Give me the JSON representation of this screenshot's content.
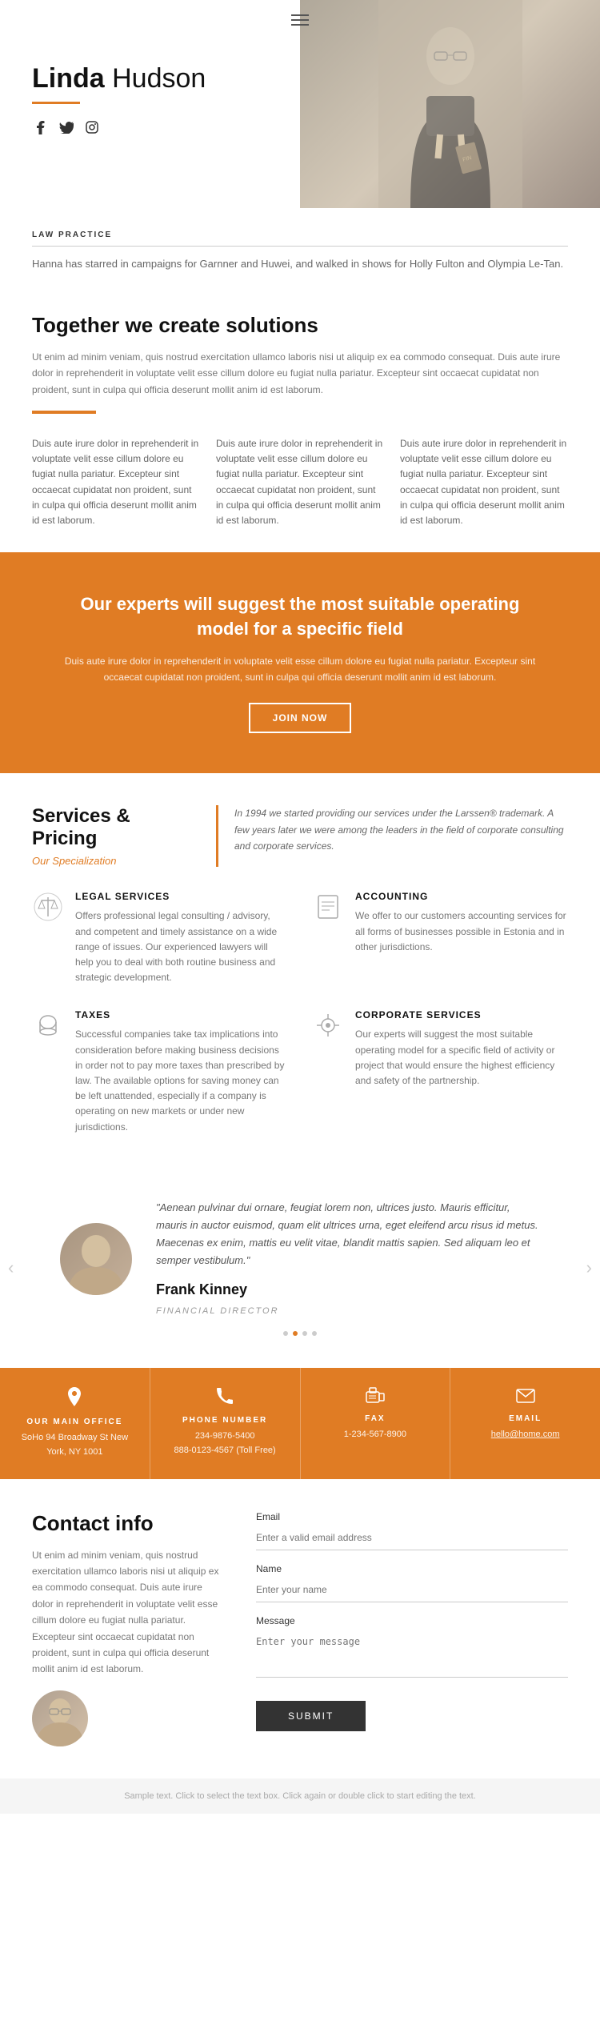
{
  "header": {
    "hamburger_label": "menu",
    "name_first": "Linda",
    "name_last": "Hudson",
    "social": [
      {
        "name": "facebook",
        "icon": "f"
      },
      {
        "name": "twitter",
        "icon": "t"
      },
      {
        "name": "instagram",
        "icon": "in"
      }
    ]
  },
  "law_section": {
    "label": "LAW PRACTICE",
    "text": "Hanna has starred in campaigns for Garnner and Huwei, and walked in shows for Holly Fulton and Olympia Le-Tan."
  },
  "solutions": {
    "title": "Together we create solutions",
    "desc": "Ut enim ad minim veniam, quis nostrud exercitation ullamco laboris nisi ut aliquip ex ea commodo consequat. Duis aute irure dolor in reprehenderit in voluptate velit esse cillum dolore eu fugiat nulla pariatur. Excepteur sint occaecat cupidatat non proident, sunt in culpa qui officia deserunt mollit anim id est laborum.",
    "col1": "Duis aute irure dolor in reprehenderit in voluptate velit esse cillum dolore eu fugiat nulla pariatur. Excepteur sint occaecat cupidatat non proident, sunt in culpa qui officia deserunt mollit anim id est laborum.",
    "col2": "Duis aute irure dolor in reprehenderit in voluptate velit esse cillum dolore eu fugiat nulla pariatur. Excepteur sint occaecat cupidatat non proident, sunt in culpa qui officia deserunt mollit anim id est laborum.",
    "col3": "Duis aute irure dolor in reprehenderit in voluptate velit esse cillum dolore eu fugiat nulla pariatur. Excepteur sint occaecat cupidatat non proident, sunt in culpa qui officia deserunt mollit anim id est laborum."
  },
  "banner": {
    "title": "Our experts will suggest the most suitable operating model for a specific field",
    "desc": "Duis aute irure dolor in reprehenderit in voluptate velit esse cillum dolore eu fugiat nulla pariatur. Excepteur sint occaecat cupidatat non proident, sunt in culpa qui officia deserunt mollit anim id est laborum.",
    "button": "JOIN NOW"
  },
  "services": {
    "title": "Services & Pricing",
    "subtitle": "Our Specialization",
    "intro": "In 1994 we started providing our services under the Larssen® trademark. A few years later we were among the leaders in the field of corporate consulting and corporate services.",
    "items": [
      {
        "id": "legal",
        "icon": "⚖",
        "title": "LEGAL SERVICES",
        "desc": "Offers professional legal consulting / advisory, and competent and timely assistance on a wide range of issues. Our experienced lawyers will help you to deal with both routine business and strategic development."
      },
      {
        "id": "accounting",
        "icon": "📄",
        "title": "ACCOUNTING",
        "desc": "We offer to our customers accounting services for all forms of businesses possible in Estonia and in other jurisdictions."
      },
      {
        "id": "taxes",
        "icon": "🗄",
        "title": "TAXES",
        "desc": "Successful companies take tax implications into consideration before making business decisions in order not to pay more taxes than prescribed by law. The available options for saving money can be left unattended, especially if a company is operating on new markets or under new jurisdictions."
      },
      {
        "id": "corporate",
        "icon": "⚙",
        "title": "CORPORATE SERVICES",
        "desc": "Our experts will suggest the most suitable operating model for a specific field of activity or project that would ensure the highest efficiency and safety of the partnership."
      }
    ]
  },
  "testimonial": {
    "quote": "\"Aenean pulvinar dui ornare, feugiat lorem non, ultrices justo. Mauris efficitur, mauris in auctor euismod, quam elit ultrices urna, eget eleifend arcu risus id metus. Maecenas ex enim, mattis eu velit vitae, blandit mattis sapien. Sed aliquam leo et semper vestibulum.\"",
    "name": "Frank Kinney",
    "role": "FINANCIAL DIRECTOR",
    "dots": [
      false,
      true,
      false,
      false
    ]
  },
  "contact_bar": [
    {
      "id": "office",
      "icon": "📍",
      "label": "OUR MAIN OFFICE",
      "value": "SoHo 94 Broadway St New\nYork, NY 1001"
    },
    {
      "id": "phone",
      "icon": "📞",
      "label": "PHONE NUMBER",
      "value": "234-9876-5400\n888-0123-4567 (Toll Free)"
    },
    {
      "id": "fax",
      "icon": "📠",
      "label": "FAX",
      "value": "1-234-567-8900"
    },
    {
      "id": "email",
      "icon": "✉",
      "label": "EMAIL",
      "value": "hello@home.com"
    }
  ],
  "contact_form": {
    "title": "Contact info",
    "text": "Ut enim ad minim veniam, quis nostrud exercitation ullamco laboris nisi ut aliquip ex ea commodo consequat. Duis aute irure dolor in reprehenderit in voluptate velit esse cillum dolore eu fugiat nulla pariatur. Excepteur sint occaecat cupidatat non proident, sunt in culpa qui officia deserunt mollit anim id est laborum.",
    "email_label": "Email",
    "email_placeholder": "Enter a valid email address",
    "name_label": "Name",
    "name_placeholder": "Enter your name",
    "message_label": "Message",
    "message_placeholder": "Enter your message",
    "submit_label": "SUBMIT"
  },
  "footer": {
    "note": "Sample text. Click to select the text box. Click again or double click to start editing the text."
  }
}
